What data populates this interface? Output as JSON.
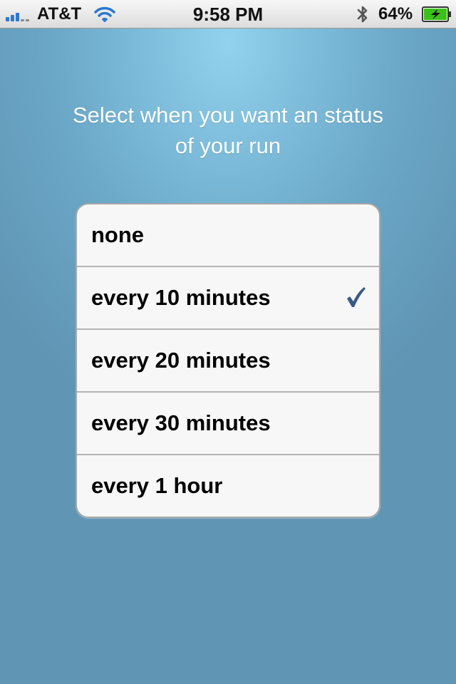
{
  "status_bar": {
    "carrier": "AT&T",
    "time": "9:58 PM",
    "battery": "64%",
    "icons": [
      "signal-icon",
      "wifi-icon",
      "bluetooth-icon",
      "battery-charging-icon"
    ]
  },
  "prompt": {
    "line1": "Select when you want an status",
    "line2": "of your run"
  },
  "options": [
    {
      "label": "none",
      "selected": false
    },
    {
      "label": "every 10 minutes",
      "selected": true
    },
    {
      "label": "every 20 minutes",
      "selected": false
    },
    {
      "label": "every 30 minutes",
      "selected": false
    },
    {
      "label": "every 1 hour",
      "selected": false
    }
  ],
  "colors": {
    "background": "#6aa6c6",
    "checkmark": "#3a5a86",
    "battery_fill": "#3cc11a",
    "signal": "#2b79d0"
  }
}
